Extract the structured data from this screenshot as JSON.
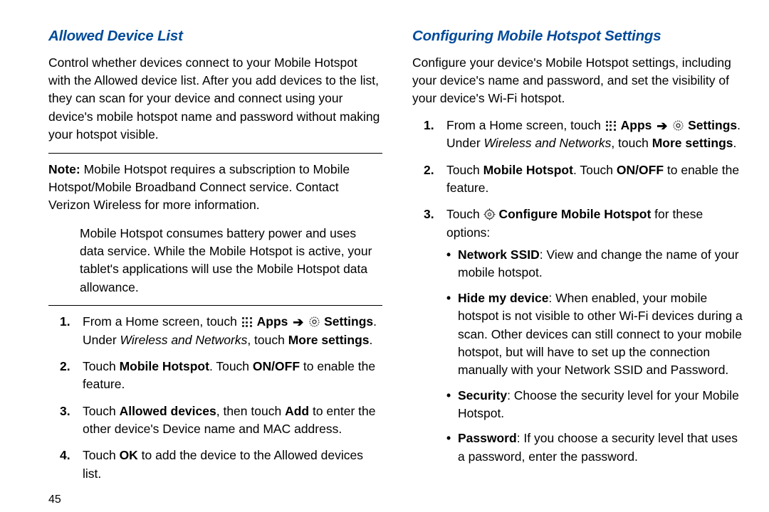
{
  "left": {
    "heading": "Allowed Device List",
    "intro": "Control whether devices connect to your Mobile Hotspot with the Allowed device list. After you add devices to the list, they can scan for your device and connect using your device's mobile hotspot name and password without making your hotspot visible.",
    "note_label": "Note:",
    "note_body1": "Mobile Hotspot requires a subscription to Mobile Hotspot/Mobile Broadband Connect service. Contact Verizon Wireless for more information.",
    "note_body2": "Mobile Hotspot consumes battery power and uses data service. While the Mobile Hotspot is active, your tablet's applications will use the Mobile Hotspot data allowance.",
    "step1_a": "From a Home screen, touch ",
    "step1_apps": "Apps",
    "step1_settings": "Settings",
    "step1_b": ". Under ",
    "step1_wn": "Wireless and Networks",
    "step1_c": ", touch ",
    "step1_more": "More settings",
    "step1_d": ".",
    "step2_a": "Touch ",
    "step2_mh": "Mobile Hotspot",
    "step2_b": ". Touch ",
    "step2_onoff": "ON/OFF",
    "step2_c": " to enable the feature.",
    "step3_a": "Touch ",
    "step3_ad": "Allowed devices",
    "step3_b": ", then touch ",
    "step3_add": "Add",
    "step3_c": " to enter the other device's Device name and MAC address.",
    "step4_a": "Touch ",
    "step4_ok": "OK",
    "step4_b": " to add the device to the Allowed devices list.",
    "page_num": "45"
  },
  "right": {
    "heading": "Configuring Mobile Hotspot Settings",
    "intro": "Configure your device's Mobile Hotspot settings, including your device's name and password, and set the visibility of your device's Wi-Fi hotspot.",
    "step1_a": "From a Home screen, touch ",
    "step1_apps": "Apps",
    "step1_settings": "Settings",
    "step1_b": ". Under ",
    "step1_wn": "Wireless and Networks",
    "step1_c": ", touch ",
    "step1_more": "More settings",
    "step1_d": ".",
    "step2_a": "Touch ",
    "step2_mh": "Mobile Hotspot",
    "step2_b": ". Touch ",
    "step2_onoff": "ON/OFF",
    "step2_c": " to enable the feature.",
    "step3_a": "Touch ",
    "step3_cfg": "Configure Mobile Hotspot",
    "step3_b": " for these options:",
    "opt1_t": "Network SSID",
    "opt1_b": ": View and change the name of your mobile hotspot.",
    "opt2_t": "Hide my device",
    "opt2_b": ": When enabled, your mobile hotspot is not visible to other Wi-Fi devices during a scan. Other devices can still connect to your mobile hotspot, but will have to set up the connection manually with your Network SSID and Password.",
    "opt3_t": "Security",
    "opt3_b": ": Choose the security level for your Mobile Hotspot.",
    "opt4_t": "Password",
    "opt4_b": ": If you choose a security level that uses a password, enter the password."
  }
}
